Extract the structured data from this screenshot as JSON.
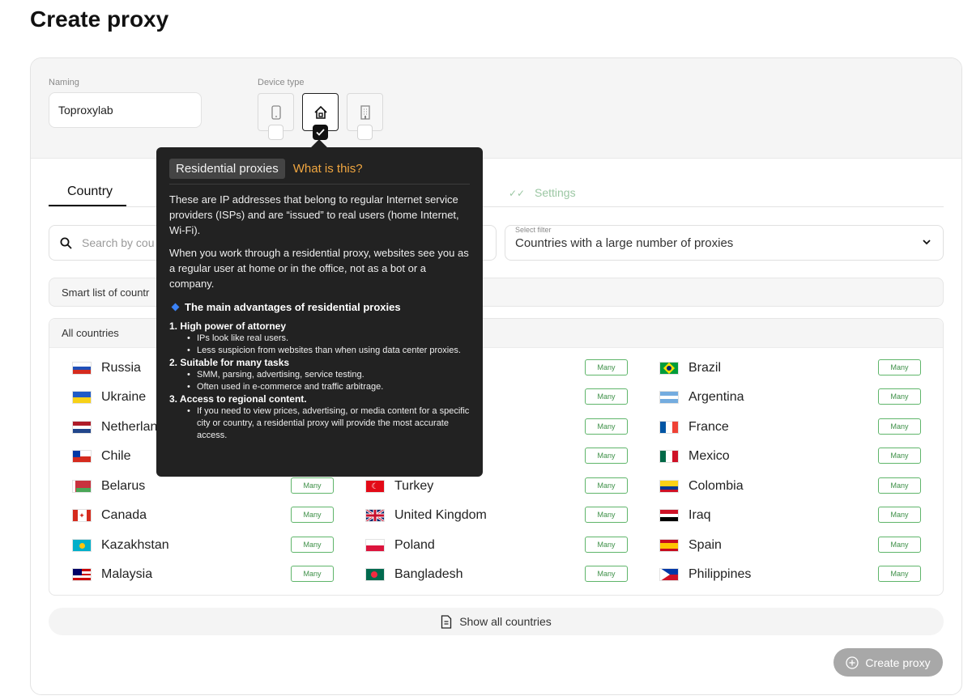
{
  "page_title": "Create proxy",
  "naming": {
    "label": "Naming",
    "value": "Toproxylab"
  },
  "device_type": {
    "label": "Device type",
    "options": [
      "mobile-icon",
      "home-icon",
      "building-icon"
    ],
    "selected": "home-icon"
  },
  "tabs": {
    "country": "Country",
    "settings": "Settings"
  },
  "search": {
    "placeholder": "Search by cou"
  },
  "filter": {
    "label": "Select filter",
    "value": "Countries with a large number of proxies"
  },
  "smart_list": "Smart list of countr",
  "all_countries": "All countries",
  "badge_label": "Many",
  "countries": {
    "col1": [
      "Russia",
      "Ukraine",
      "Netherlan",
      "Chile",
      "Belarus",
      "Canada",
      "Kazakhstan",
      "Malaysia"
    ],
    "col2": [
      "",
      "",
      "",
      "",
      "Turkey",
      "United Kingdom",
      "Poland",
      "Bangladesh"
    ],
    "col3": [
      "Brazil",
      "Argentina",
      "France",
      "Mexico",
      "Colombia",
      "Iraq",
      "Spain",
      "Philippines"
    ]
  },
  "show_all": "Show all countries",
  "create_button": "Create proxy",
  "tooltip": {
    "pill": "Residential proxies",
    "link": "What is this?",
    "p1": "These are IP addresses that belong to regular Internet service providers (ISPs) and are “issued” to real users (home Internet, Wi-Fi).",
    "p2": "When you work through a residential proxy, websites see you as a regular user at home or in the office, not as a bot or a company.",
    "advantages_title": "The main advantages of residential proxies",
    "s1": "1. High power of attorney",
    "s1_i1": "IPs look like real users.",
    "s1_i2": "Less suspicion from websites than when using data center proxies.",
    "s2": "2. Suitable for many tasks",
    "s2_i1": "SMM, parsing, advertising, service testing.",
    "s2_i2": "Often used in e-commerce and traffic arbitrage.",
    "s3": "3. Access to regional content.",
    "s3_i1": "If you need to view prices, advertising, or media content for a specific city or country, a residential proxy will provide the most accurate access."
  }
}
